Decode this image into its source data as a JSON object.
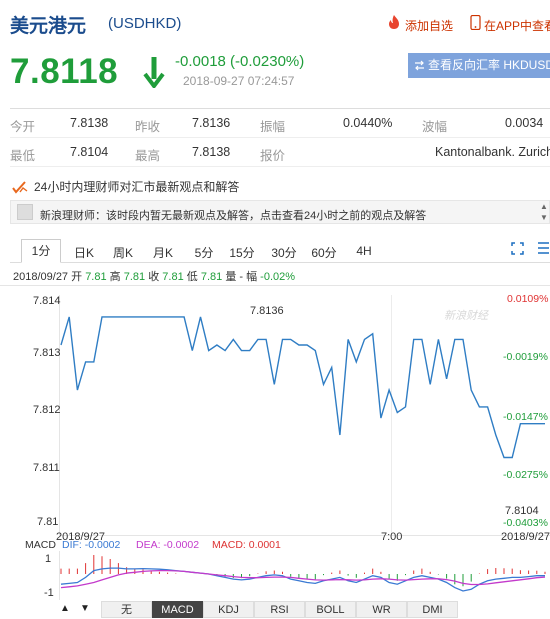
{
  "header": {
    "title": "美元港元",
    "code": "(USDHKD)",
    "favorite_label": "添加自选",
    "app_label": "在APP中查看"
  },
  "quote": {
    "price": "7.8118",
    "change": "-0.0018 (-0.0230%)",
    "time": "2018-09-27 07:24:57",
    "reverse_button": "查看反向汇率 HKDUSD",
    "colors": {
      "down": "#1f9d3a",
      "up": "#e03333",
      "accent": "#1b4c8d"
    }
  },
  "table": {
    "row1": [
      {
        "label": "今开",
        "value": "7.8138"
      },
      {
        "label": "昨收",
        "value": "7.8136"
      },
      {
        "label": "振幅",
        "value": "0.0440%"
      },
      {
        "label": "波幅",
        "value": "0.0034"
      }
    ],
    "row2": [
      {
        "label": "最低",
        "value": "7.8104"
      },
      {
        "label": "最高",
        "value": "7.8138"
      },
      {
        "label": "报价",
        "value": "Kantonalbank. Zurich"
      }
    ]
  },
  "expert": {
    "heading": "24小时内理财师对汇市最新观点和解答",
    "notice": "新浪理财师：该时段内暂无最新观点及解答，点击查看24小时之前的观点及解答"
  },
  "tabs": [
    "1分",
    "日K",
    "周K",
    "月K",
    "5分",
    "15分",
    "30分",
    "60分",
    "4H"
  ],
  "active_tab": "1分",
  "info_line": {
    "date": "2018/09/27",
    "open_label": "开",
    "open": "7.81",
    "high_label": "高",
    "high": "7.81",
    "close_label": "收",
    "close": "7.81",
    "low_label": "低",
    "low": "7.81",
    "vol_label": "量",
    "vol": "-",
    "amp_label": "幅",
    "amp": "-0.02%"
  },
  "chart_data": {
    "type": "line",
    "y_ticks": [
      "7.814",
      "7.813",
      "7.812",
      "7.811",
      "7.81"
    ],
    "pct_ticks": [
      "0.0109%",
      "-0.0019%",
      "-0.0147%",
      "-0.0275%",
      "-0.0403%"
    ],
    "x_labels": [
      "2018/9/27",
      "7:00",
      "2018/9/27"
    ],
    "ylim": [
      7.81,
      7.8142
    ],
    "prev_close_label": "7.8136",
    "last_label": "7.8104",
    "watermark": "新浪财经",
    "values": [
      7.8132,
      7.8137,
      7.8124,
      7.8129,
      7.8129,
      7.8137,
      7.8137,
      7.8137,
      7.8137,
      7.8137,
      7.8137,
      7.8137,
      7.8137,
      7.8137,
      7.8137,
      7.8137,
      7.8131,
      7.8137,
      7.8131,
      7.8132,
      7.8131,
      7.8133,
      7.8131,
      7.8131,
      7.8133,
      7.8133,
      7.8125,
      7.8133,
      7.8133,
      7.8132,
      7.8132,
      7.8131,
      7.8125,
      7.8128,
      7.8116,
      7.8133,
      7.8129,
      7.8133,
      7.8134,
      7.8119,
      7.8124,
      7.812,
      7.8121,
      7.8133,
      7.8133,
      7.8125,
      7.8133,
      7.8126,
      7.8133,
      7.8133,
      7.8124,
      7.8121,
      7.8121,
      7.8116,
      7.8112,
      7.8112,
      7.8118,
      7.8118,
      7.8118,
      7.8118
    ],
    "macd": {
      "label": "MACD",
      "dif_label": "DIF: -0.0002",
      "dea_label": "DEA: -0.0002",
      "macd_label": "MACD: 0.0001",
      "y_ticks": [
        "1",
        "-1"
      ],
      "dif": [
        -0.6,
        -0.55,
        -0.5,
        -0.2,
        0.2,
        0.3,
        0.35,
        0.35,
        0.3,
        0.3,
        0.32,
        0.3,
        0.28,
        0.25,
        0.2,
        0.15,
        0.1,
        0.05,
        0.0,
        -0.1,
        -0.2,
        -0.3,
        -0.35,
        -0.3,
        -0.2,
        -0.1,
        -0.05,
        -0.1,
        -0.3,
        -0.4,
        -0.5,
        -0.55,
        -0.4,
        -0.3,
        -0.2,
        -0.4,
        -0.5,
        -0.3,
        -0.1,
        -0.2,
        -0.5,
        -0.6,
        -0.4,
        -0.2,
        -0.1,
        -0.2,
        -0.3,
        -0.5,
        -0.8,
        -1.0,
        -0.9,
        -0.6,
        -0.4,
        -0.3,
        -0.25,
        -0.2,
        -0.2,
        -0.15,
        -0.1,
        -0.1
      ],
      "dea": [
        -0.8,
        -0.75,
        -0.7,
        -0.6,
        -0.5,
        -0.35,
        -0.2,
        -0.05,
        0.05,
        0.1,
        0.15,
        0.18,
        0.2,
        0.2,
        0.18,
        0.15,
        0.1,
        0.05,
        0.0,
        -0.05,
        -0.1,
        -0.15,
        -0.2,
        -0.22,
        -0.22,
        -0.2,
        -0.18,
        -0.18,
        -0.2,
        -0.25,
        -0.3,
        -0.35,
        -0.36,
        -0.35,
        -0.33,
        -0.34,
        -0.36,
        -0.35,
        -0.3,
        -0.28,
        -0.3,
        -0.35,
        -0.36,
        -0.33,
        -0.3,
        -0.28,
        -0.28,
        -0.33,
        -0.42,
        -0.55,
        -0.62,
        -0.62,
        -0.58,
        -0.52,
        -0.46,
        -0.4,
        -0.34,
        -0.28,
        -0.22,
        -0.18
      ]
    }
  },
  "bottom_tabs": [
    "无",
    "MACD",
    "KDJ",
    "RSI",
    "BOLL",
    "WR",
    "DMI"
  ],
  "bottom_active": "MACD"
}
